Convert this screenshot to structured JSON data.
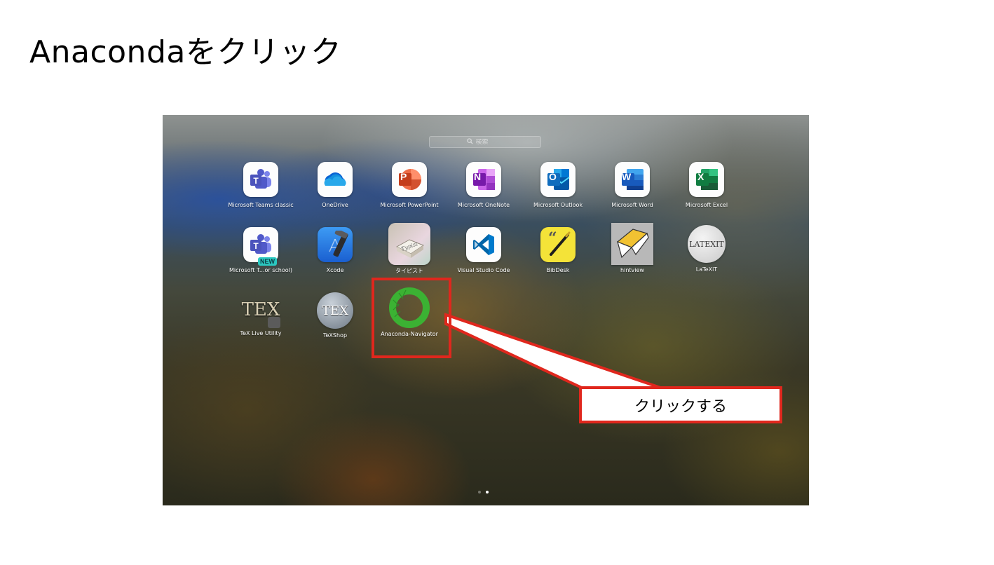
{
  "slide": {
    "title": "Anacondaをクリック"
  },
  "launchpad": {
    "search": {
      "placeholder": "検索",
      "icon": "magnifier-icon"
    },
    "apps": [
      {
        "label": "Microsoft Teams classic",
        "icon": "teams-icon"
      },
      {
        "label": "OneDrive",
        "icon": "onedrive-icon"
      },
      {
        "label": "Microsoft PowerPoint",
        "icon": "powerpoint-icon",
        "letter": "P"
      },
      {
        "label": "Microsoft OneNote",
        "icon": "onenote-icon",
        "letter": "N"
      },
      {
        "label": "Microsoft Outlook",
        "icon": "outlook-icon",
        "letter": "O"
      },
      {
        "label": "Microsoft Word",
        "icon": "word-icon",
        "letter": "W"
      },
      {
        "label": "Microsoft Excel",
        "icon": "excel-icon",
        "letter": "X"
      },
      {
        "label": "Microsoft T...or school)",
        "icon": "teams-new-icon",
        "badge": "NEW"
      },
      {
        "label": "Xcode",
        "icon": "xcode-icon"
      },
      {
        "label": "タイピスト",
        "icon": "typist-icon"
      },
      {
        "label": "Visual Studio Code",
        "icon": "vscode-icon"
      },
      {
        "label": "BibDesk",
        "icon": "bibdesk-icon"
      },
      {
        "label": "hintview",
        "icon": "hintview-icon"
      },
      {
        "label": "LaTeXiT",
        "icon": "latexit-icon",
        "icon_text": "LATEXIT"
      },
      {
        "label": "TeX Live Utility",
        "icon": "texlive-utility-icon",
        "icon_text": "TEX"
      },
      {
        "label": "TeXShop",
        "icon": "texshop-icon",
        "icon_text": "TEX"
      },
      {
        "label": "Anaconda-Navigator",
        "icon": "anaconda-navigator-icon"
      }
    ],
    "pages": {
      "count": 2,
      "current": 2
    }
  },
  "annotation": {
    "callout_text": "クリックする",
    "color": "#e0271d"
  }
}
